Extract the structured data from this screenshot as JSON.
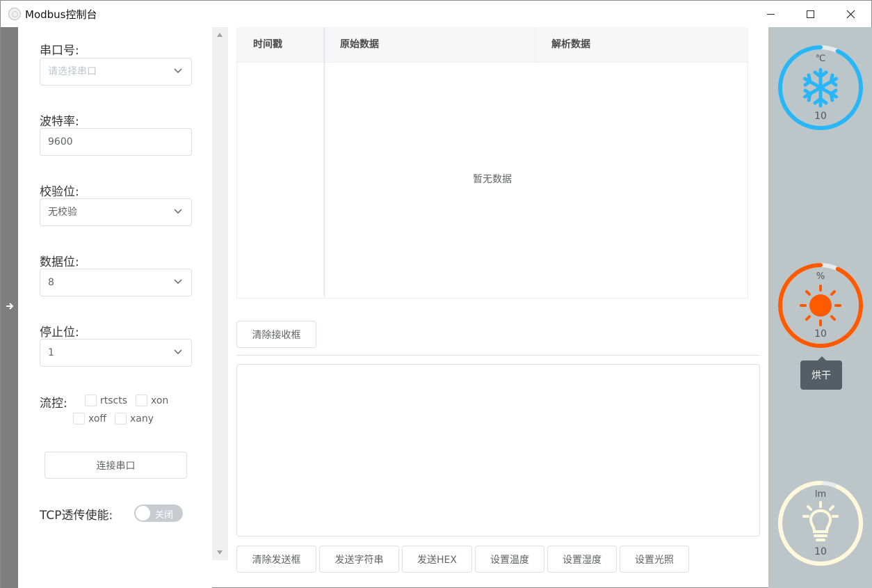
{
  "window": {
    "title": "Modbus控制台"
  },
  "settings": {
    "port_label": "串口号:",
    "port_placeholder": "请选择串口",
    "baud_label": "波特率:",
    "baud_value": "9600",
    "parity_label": "校验位:",
    "parity_value": "无校验",
    "databits_label": "数据位:",
    "databits_value": "8",
    "stopbits_label": "停止位:",
    "stopbits_value": "1",
    "flow_label": "流控:",
    "flow_options": [
      "rtscts",
      "xon",
      "xoff",
      "xany"
    ],
    "connect_label": "连接串口",
    "tcp_label": "TCP透传使能:",
    "tcp_switch_text": "关闭"
  },
  "table": {
    "columns": [
      "时间戳",
      "原始数据",
      "解析数据"
    ],
    "empty_text": "暂无数据"
  },
  "buttons": {
    "clear_receive": "清除接收框",
    "clear_send": "清除发送框",
    "send_string": "发送字符串",
    "send_hex": "发送HEX",
    "set_temperature": "设置温度",
    "set_humidity": "设置湿度",
    "set_light": "设置光照"
  },
  "gauges": [
    {
      "unit": "℃",
      "value": "10",
      "color": "#29b6f6",
      "icon": "snowflake-icon",
      "fill": 0.93
    },
    {
      "unit": "%",
      "value": "10",
      "color": "#ff5a00",
      "icon": "sun-icon",
      "fill": 0.93
    },
    {
      "unit": "lm",
      "value": "10",
      "color": "#fff8dc",
      "icon": "lightbulb-icon",
      "fill": 0.93
    }
  ],
  "tooltip": {
    "text": "烘干"
  }
}
